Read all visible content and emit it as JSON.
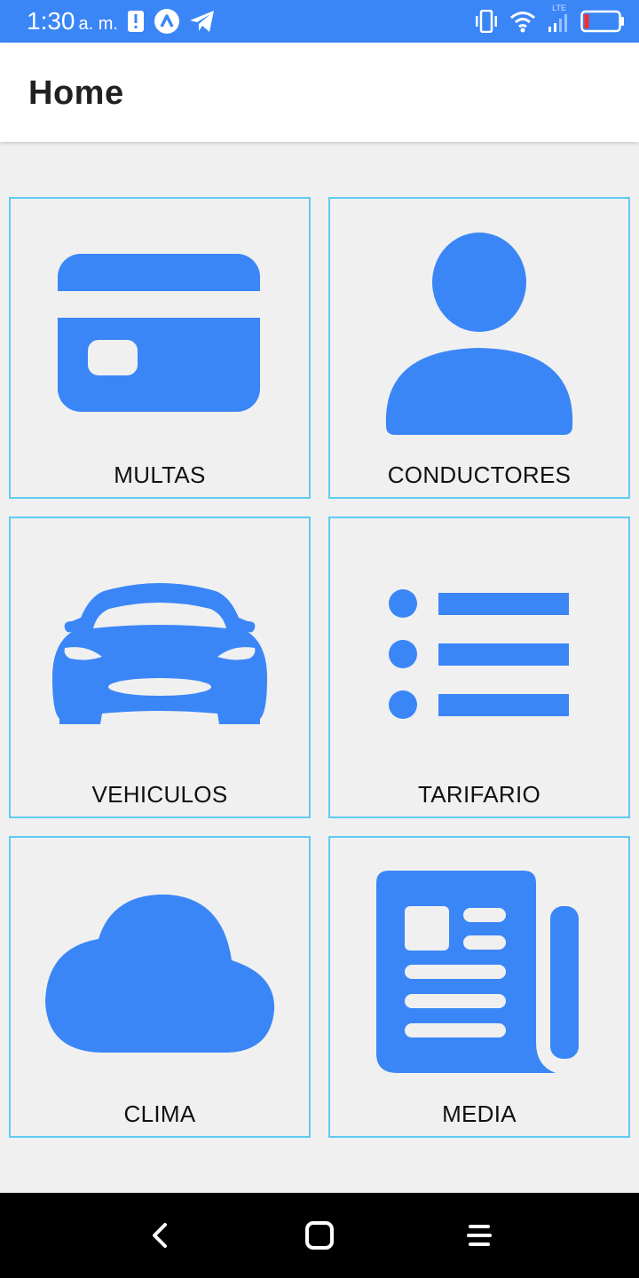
{
  "status_bar": {
    "time": "1:30",
    "ampm": "a. m.",
    "network_type": "LTE",
    "color": "#3a86f7",
    "icons": [
      "alert-icon",
      "app-logo-icon",
      "telegram-icon",
      "vibrate-icon",
      "wifi-icon",
      "signal-icon",
      "battery-low-icon"
    ]
  },
  "app_bar": {
    "title": "Home"
  },
  "accent_color": "#3a86f7",
  "tile_border_color": "#5ecbf2",
  "tiles": [
    {
      "label": "MULTAS",
      "icon": "credit-card-icon"
    },
    {
      "label": "CONDUCTORES",
      "icon": "person-icon"
    },
    {
      "label": "VEHICULOS",
      "icon": "car-icon"
    },
    {
      "label": "TARIFARIO",
      "icon": "list-icon"
    },
    {
      "label": "CLIMA",
      "icon": "cloud-icon"
    },
    {
      "label": "MEDIA",
      "icon": "newspaper-icon"
    }
  ],
  "nav_bar": {
    "buttons": [
      "back-icon",
      "home-icon",
      "menu-icon"
    ]
  }
}
